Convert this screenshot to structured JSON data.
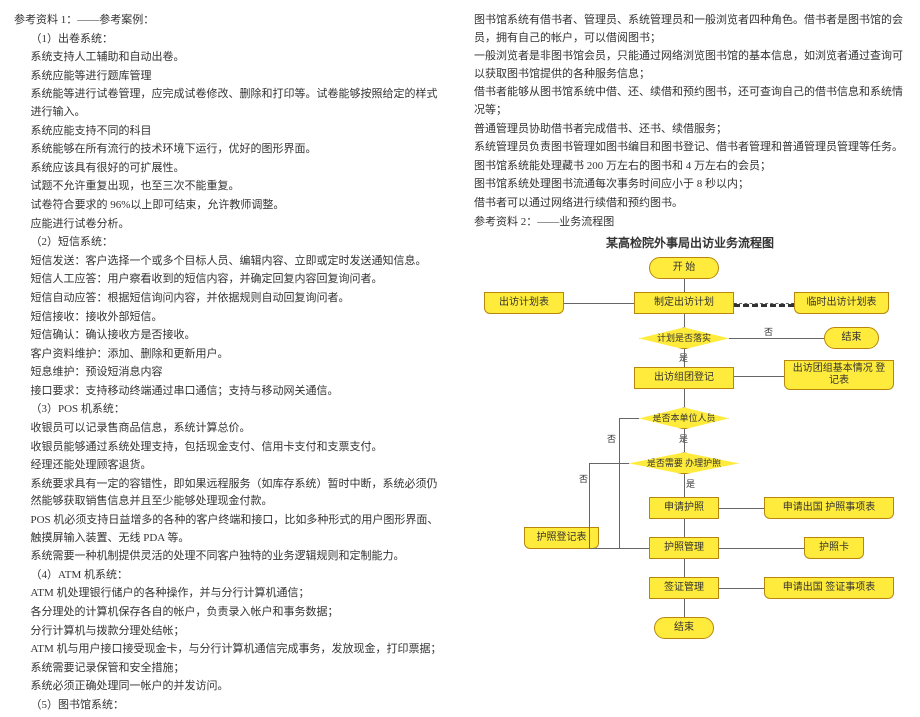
{
  "left": {
    "l1": "参考资料 1：——参考案例：",
    "l2": "（1）出卷系统：",
    "l3": "系统支持人工辅助和自动出卷。",
    "l4": "系统应能等进行题库管理",
    "l5": "系统能等进行试卷管理，应完成试卷修改、删除和打印等。试卷能够按照给定的样式进行输入。",
    "l6": "系统应能支持不同的科目",
    "l7": "系统能够在所有流行的技术环境下运行，优好的图形界面。",
    "l8": "系统应该具有很好的可扩展性。",
    "l9": "试题不允许重复出现，也至三次不能重复。",
    "l10": "试卷符合要求的 96%以上即可结束，允许教师调整。",
    "l11": "应能进行试卷分析。",
    "l12": "（2）短信系统：",
    "l13": "短信发送：客户选择一个或多个目标人员、编辑内容、立即或定时发送通知信息。",
    "l14": "短信人工应答：用户察看收到的短信内容，并确定回复内容回复询问者。",
    "l15": "短信自动应答：根据短信询问内容，并依据规则自动回复询问者。",
    "l16": "短信接收：接收外部短信。",
    "l17": "短信确认：确认接收方是否接收。",
    "l18": "客户资料维护：添加、删除和更新用户。",
    "l19": "短息维护：预设短消息内容",
    "l20": "接口要求：支持移动终端通过串口通信；支持与移动网关通信。",
    "l21": "（3）POS 机系统：",
    "l22": "收银员可以记录售商品信息，系统计算总价。",
    "l23": "收银员能够通过系统处理支持，包括现金支付、信用卡支付和支票支付。",
    "l24": "经理还能处理顾客退货。",
    "l25": "系统要求具有一定的容错性，即如果远程服务（如库存系统）暂时中断，系统必须仍然能够获取销售信息并且至少能够处理现金付款。",
    "l26": "POS 机必须支持日益增多的各种的客户终端和接口，比如多种形式的用户图形界面、触摸屏输入装置、无线 PDA 等。",
    "l27": "系统需要一种机制提供灵活的处理不同客户独特的业务逻辑规则和定制能力。",
    "l28": "（4）ATM 机系统：",
    "l29": "ATM 机处理银行储户的各种操作，并与分行计算机通信；",
    "l30": "各分理处的计算机保存各自的帐户，负责录入帐户和事务数据；",
    "l31": "分行计算机与拨款分理处结帐；",
    "l32": "ATM 机与用户接口接受现金卡，与分行计算机通信完成事务，发放现金，打印票据；",
    "l33": "系统需要记录保管和安全措施；",
    "l34": "系统必须正确处理同一帐户的并发访问。",
    "l35": "（5）图书馆系统："
  },
  "right": {
    "r1": "图书馆系统有借书者、管理员、系统管理员和一般浏览者四种角色。借书者是图书馆的会员，拥有自己的帐户，可以借阅图书；",
    "r2": "一般浏览者是非图书馆会员，只能通过网络浏览图书馆的基本信息，如浏览者通过查询可以获取图书馆提供的各种服务信息；",
    "r3": "借书者能够从图书馆系统中借、还、续借和预约图书，还可查询自己的借书信息和系统情况等；",
    "r4": "普通管理员协助借书者完成借书、还书、续借服务；",
    "r5": "系统管理员负责图书管理如图书编目和图书登记、借书者管理和普通管理员管理等任务。",
    "r6": "图书馆系统能处理藏书 200 万左右的图书和 4 万左右的会员；",
    "r7": "图书馆系统处理图书流通每次事务时间应小于 8 秒以内；",
    "r8": "借书者可以通过网络进行续借和预约图书。",
    "r9": "参考资料 2：——业务流程图",
    "title": "某高检院外事局出访业务流程图"
  },
  "flow": {
    "start": "开  始",
    "plan_doc": "出访计划表",
    "make_plan": "制定出访计划",
    "temp_plan": "临时出访计划表",
    "confirm": "计划是否落实",
    "end1": "结束",
    "register": "出访组团登记",
    "team_doc": "出访团组基本情况\n登记表",
    "is_unit": "是否本单位人员",
    "need_passport": "是否需要  办理护照",
    "passport_reg": "护照登记表",
    "apply_passport": "申请护照",
    "passport_item": "申请出国  护照事项表",
    "passport_mgmt": "护照管理",
    "passport_card": "护照卡",
    "visa_mgmt": "签证管理",
    "visa_item": "申请出国  签证事项表",
    "end2": "结束",
    "yes": "是",
    "no": "否"
  }
}
